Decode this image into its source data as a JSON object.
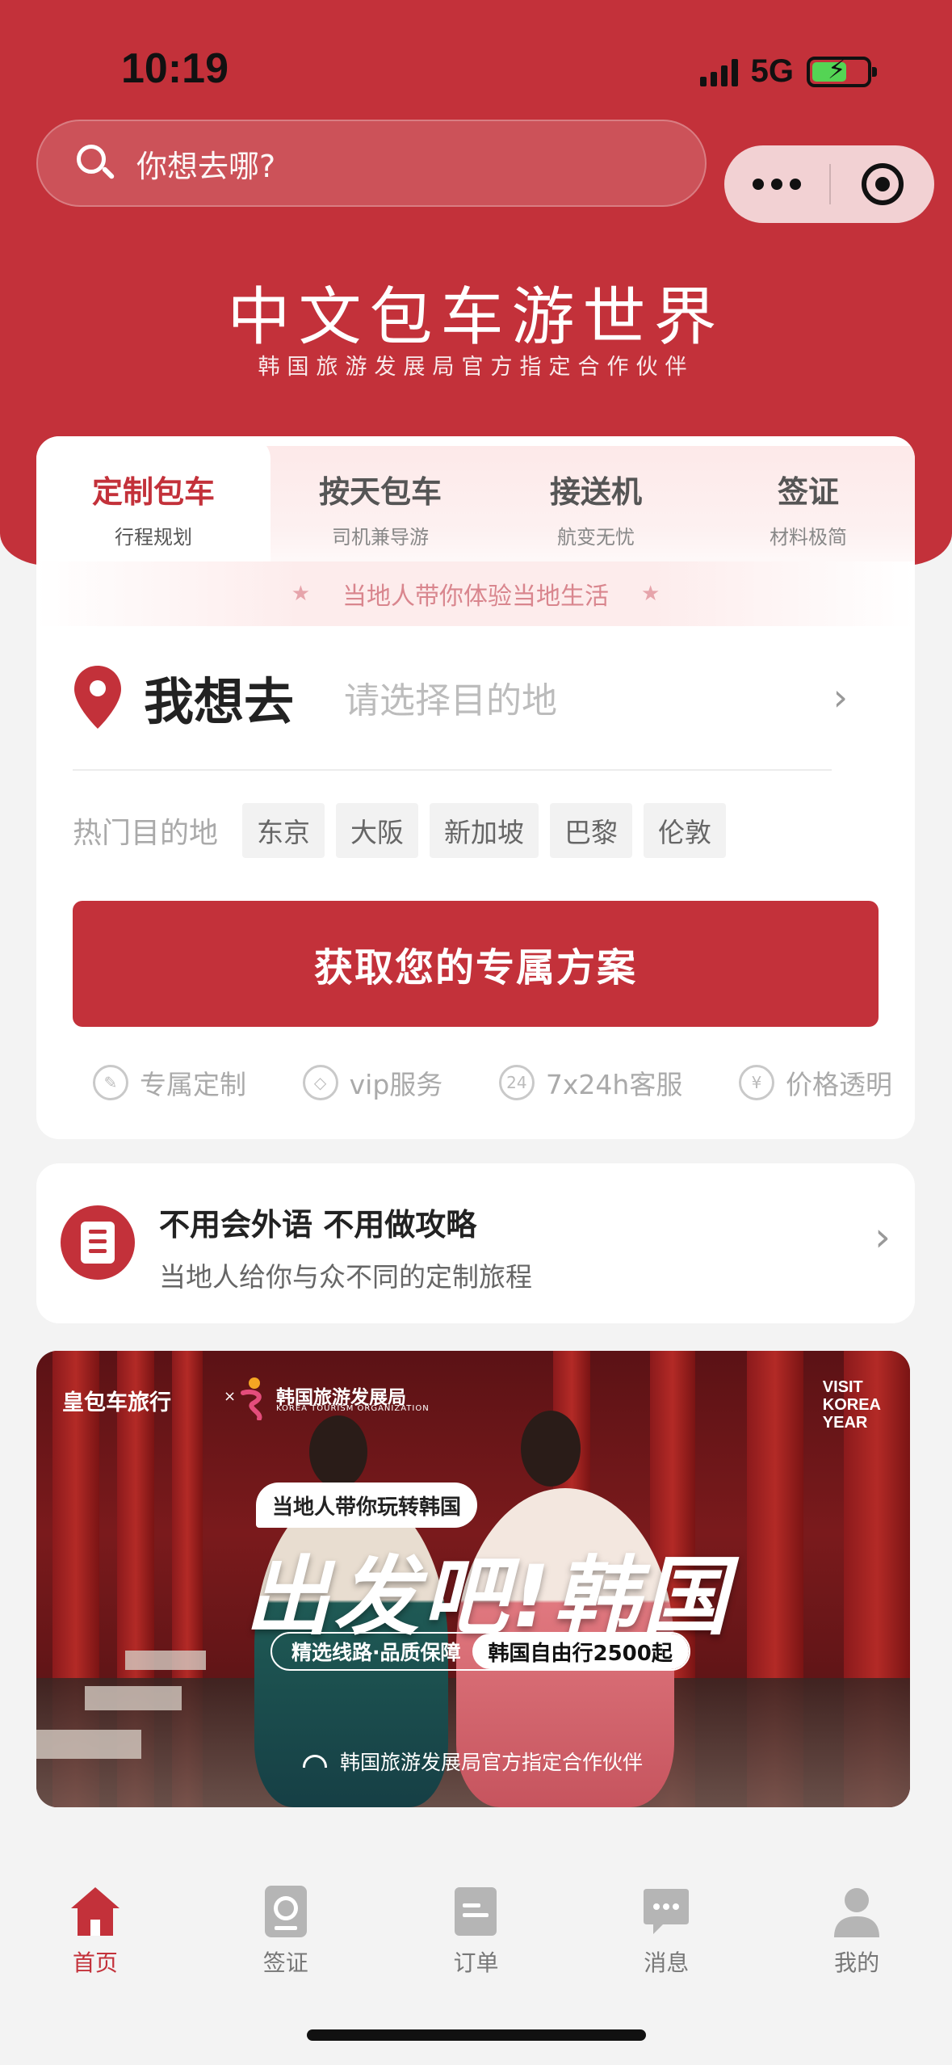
{
  "status_bar": {
    "time": "10:19",
    "network": "5G"
  },
  "search": {
    "placeholder": "你想去哪?"
  },
  "brand": {
    "title": "中文包车游世界",
    "subtitle": "韩国旅游发展局官方指定合作伙伴"
  },
  "tabs": [
    {
      "title": "定制包车",
      "sub": "行程规划"
    },
    {
      "title": "按天包车",
      "sub": "司机兼导游"
    },
    {
      "title": "接送机",
      "sub": "航变无忧"
    },
    {
      "title": "签证",
      "sub": "材料极简"
    }
  ],
  "slogan": "当地人带你体验当地生活",
  "destination": {
    "label": "我想去",
    "placeholder": "请选择目的地"
  },
  "hot": {
    "label": "热门目的地",
    "tags": [
      "东京",
      "大阪",
      "新加坡",
      "巴黎",
      "伦敦"
    ]
  },
  "cta": {
    "label": "获取您的专属方案"
  },
  "features": [
    {
      "icon": "pencil-icon",
      "glyph": "✎",
      "label": "专属定制"
    },
    {
      "icon": "diamond-icon",
      "glyph": "◇",
      "label": "vip服务"
    },
    {
      "icon": "clock-24-icon",
      "glyph": "24",
      "label": "7x24h客服"
    },
    {
      "icon": "yen-icon",
      "glyph": "¥",
      "label": "价格透明"
    }
  ],
  "info": {
    "title": "不用会外语 不用做攻略",
    "subtitle": "当地人给你与众不同的定制旅程"
  },
  "banner": {
    "logo1": "皇包车旅行",
    "sep": "×",
    "logo2": "韩国旅游发展局",
    "logo2_en": "KOREA TOURISM ORGANIZATION",
    "visit": [
      "VISIT",
      "KOREA",
      "YEAR"
    ],
    "bubble": "当地人带你玩转韩国",
    "title": "出发吧!韩国",
    "pill_left": "精选线路·品质保障",
    "pill_right": "韩国自由行2500起",
    "footer": "韩国旅游发展局官方指定合作伙伴"
  },
  "tabbar": [
    {
      "icon": "home-icon",
      "label": "首页",
      "active": true
    },
    {
      "icon": "passport-icon",
      "label": "签证",
      "active": false
    },
    {
      "icon": "order-icon",
      "label": "订单",
      "active": false
    },
    {
      "icon": "message-icon",
      "label": "消息",
      "active": false
    },
    {
      "icon": "user-icon",
      "label": "我的",
      "active": false
    }
  ],
  "colors": {
    "brand": "#c3313a",
    "background": "#f3f3f3"
  }
}
